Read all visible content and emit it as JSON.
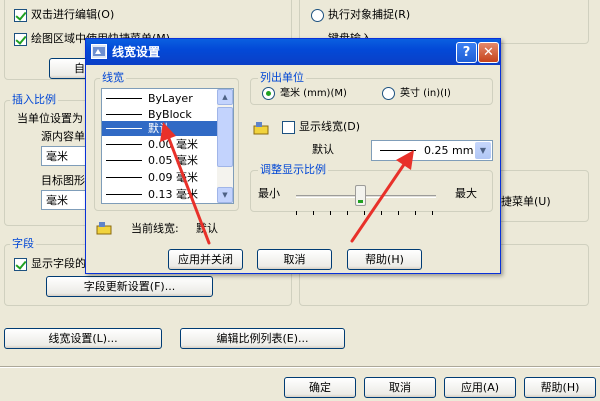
{
  "background": {
    "checkbox_double_click_edit": "双击进行编辑(O)",
    "checkbox_draw_area_partial": "绘图区域中使用快捷菜单(M)",
    "button_user_defined_partial": "自定",
    "radio_object_snap": "执行对象捕捉(R)",
    "radio_keyboard_partial": "键盘输入",
    "insert_scale_title": "插入比例",
    "insert_units_label": "当单位设置为",
    "source_content_label": "源内容单",
    "source_unit_value": "毫米",
    "target_drawing_label": "目标图形",
    "target_unit_value": "毫米",
    "shortcut_menu_partial": "捷菜单(U)",
    "field_title": "字段",
    "field_checkbox_partial": "显示字段的",
    "field_update_button": "字段更新设置(F)...",
    "lineweight_button": "线宽设置(L)...",
    "scale_list_button": "编辑比例列表(E)...",
    "ok_button": "确定",
    "cancel_button": "取消",
    "apply_button": "应用(A)",
    "help_button": "帮助(H)"
  },
  "dialog": {
    "title": "线宽设置",
    "help_glyph": "?",
    "close_glyph": "✕",
    "lineweight_group": "线宽",
    "lineweights": [
      "ByLayer",
      "ByBlock",
      "默认",
      "0.00 毫米",
      "0.05 毫米",
      "0.09 毫米",
      "0.13 毫米"
    ],
    "selected_index": 2,
    "current_label": "当前线宽:",
    "current_value": "默认",
    "units_group": "列出单位",
    "unit_mm": "毫米 (mm)(M)",
    "unit_inch": "英寸 (in)(I)",
    "selected_unit": "mm",
    "display_checkbox": "显示线宽(D)",
    "display_checked": false,
    "default_label": "默认",
    "default_value": "0.25 mm",
    "scale_group": "调整显示比例",
    "scale_min": "最小",
    "scale_max": "最大",
    "apply_close_button": "应用并关闭",
    "cancel_button": "取消",
    "help_button": "帮助(H)"
  },
  "colors": {
    "annotation_arrow": "#e8312a",
    "title_bar": "#0349d7",
    "selection": "#316ac5"
  }
}
